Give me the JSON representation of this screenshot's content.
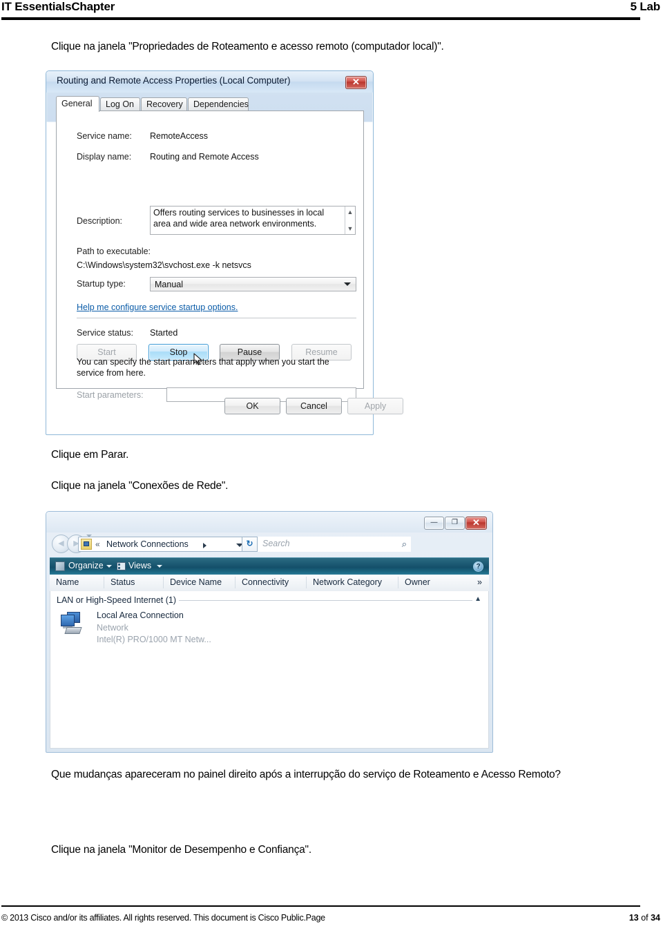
{
  "header": {
    "left_title": "IT EssentialsChapter",
    "right_title": "5 Lab"
  },
  "body": {
    "instruction_1": "Clique na janela \"Propriedades de Roteamento e acesso remoto (computador local)\".",
    "instruction_2": "Clique em Parar.",
    "instruction_3": "Clique na janela \"Conexões de Rede\".",
    "question": "Que mudanças apareceram no painel direito após a interrupção do serviço de Roteamento e Acesso Remoto?",
    "instruction_4": "Clique na janela \"Monitor de Desempenho e Confiança\"."
  },
  "service_dialog": {
    "title": "Routing and Remote Access Properties (Local Computer)",
    "close_glyph": "✕",
    "tabs": [
      {
        "label": "General",
        "active": true
      },
      {
        "label": "Log On",
        "active": false
      },
      {
        "label": "Recovery",
        "active": false
      },
      {
        "label": "Dependencies",
        "active": false
      }
    ],
    "fields": {
      "service_name_label": "Service name:",
      "service_name_value": "RemoteAccess",
      "display_name_label": "Display name:",
      "display_name_value": "Routing and Remote Access",
      "description_label": "Description:",
      "description_value": "Offers routing services to businesses in local area and wide area network environments.",
      "path_label": "Path to executable:",
      "path_value": "C:\\Windows\\system32\\svchost.exe -k netsvcs",
      "startup_type_label": "Startup type:",
      "startup_type_value": "Manual",
      "help_link": "Help me configure service startup options.",
      "service_status_label": "Service status:",
      "service_status_value": "Started",
      "hint": "You can specify the start parameters that apply when you start the service from here.",
      "start_parameters_label": "Start parameters:",
      "start_parameters_value": ""
    },
    "service_buttons": [
      {
        "label": "Start",
        "state": "disabled"
      },
      {
        "label": "Stop",
        "state": "hot"
      },
      {
        "label": "Pause",
        "state": "normal"
      },
      {
        "label": "Resume",
        "state": "disabled"
      }
    ],
    "dialog_buttons": [
      {
        "label": "OK",
        "state": "normal"
      },
      {
        "label": "Cancel",
        "state": "normal"
      },
      {
        "label": "Apply",
        "state": "disabled"
      }
    ],
    "scrollbar": {
      "up": "▲",
      "down": "▼"
    }
  },
  "network_window": {
    "window_controls": {
      "minimize": "—",
      "maximize": "❐",
      "close": "✕"
    },
    "address": {
      "breadcrumb_chevron": "«",
      "breadcrumb": "Network Connections",
      "search_placeholder": "Search",
      "search_icon": "search-icon",
      "refresh_icon": "refresh-icon"
    },
    "toolbar": {
      "organize_label": "Organize",
      "views_label": "Views",
      "help_glyph": "?"
    },
    "columns": [
      "Name",
      "Status",
      "Device Name",
      "Connectivity",
      "Network Category",
      "Owner"
    ],
    "columns_overflow": "»",
    "group": {
      "label": "LAN or High-Speed Internet (1)",
      "collapse_glyph": "▲"
    },
    "items": [
      {
        "name": "Local Area Connection",
        "status": "Network",
        "device": "Intel(R) PRO/1000 MT Netw..."
      }
    ]
  },
  "footer": {
    "left": "© 2013 Cisco and/or its affiliates. All rights reserved. This document is Cisco Public.Page",
    "page_number": "13",
    "page_of": " of ",
    "page_total": "34"
  }
}
